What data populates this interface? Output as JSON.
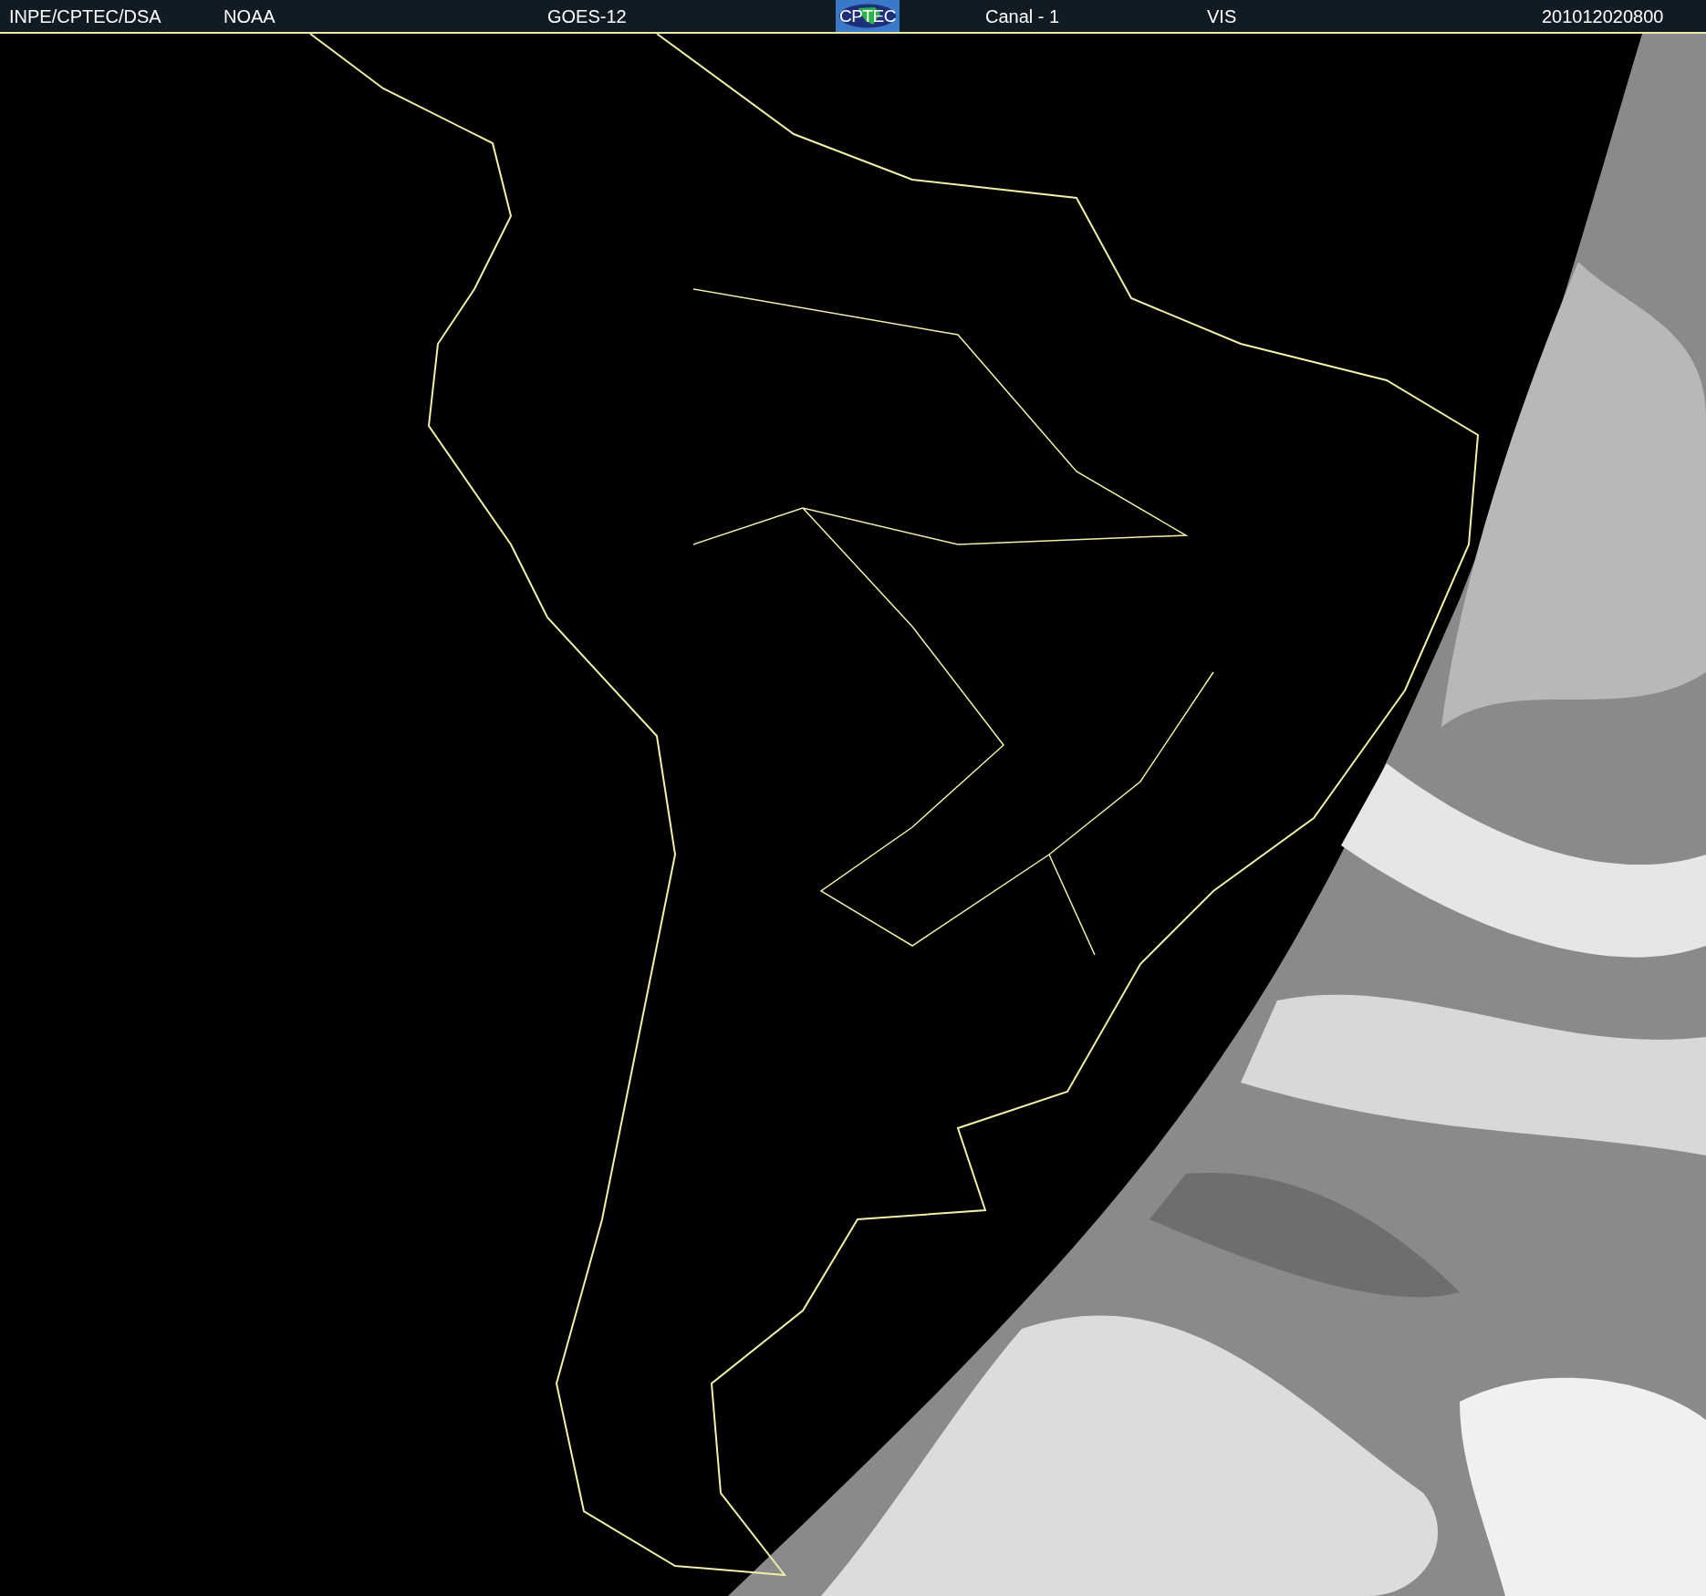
{
  "header": {
    "items": [
      {
        "kind": "text",
        "text": "INPE/CPTEC/DSA"
      },
      {
        "kind": "text",
        "text": "NOAA"
      },
      {
        "kind": "text",
        "text": "GOES-12"
      },
      {
        "kind": "logo",
        "text": "CPTEC"
      },
      {
        "kind": "text",
        "text": "Canal - 1"
      },
      {
        "kind": "text",
        "text": "VIS"
      },
      {
        "kind": "text",
        "text": "201012020800"
      }
    ]
  }
}
